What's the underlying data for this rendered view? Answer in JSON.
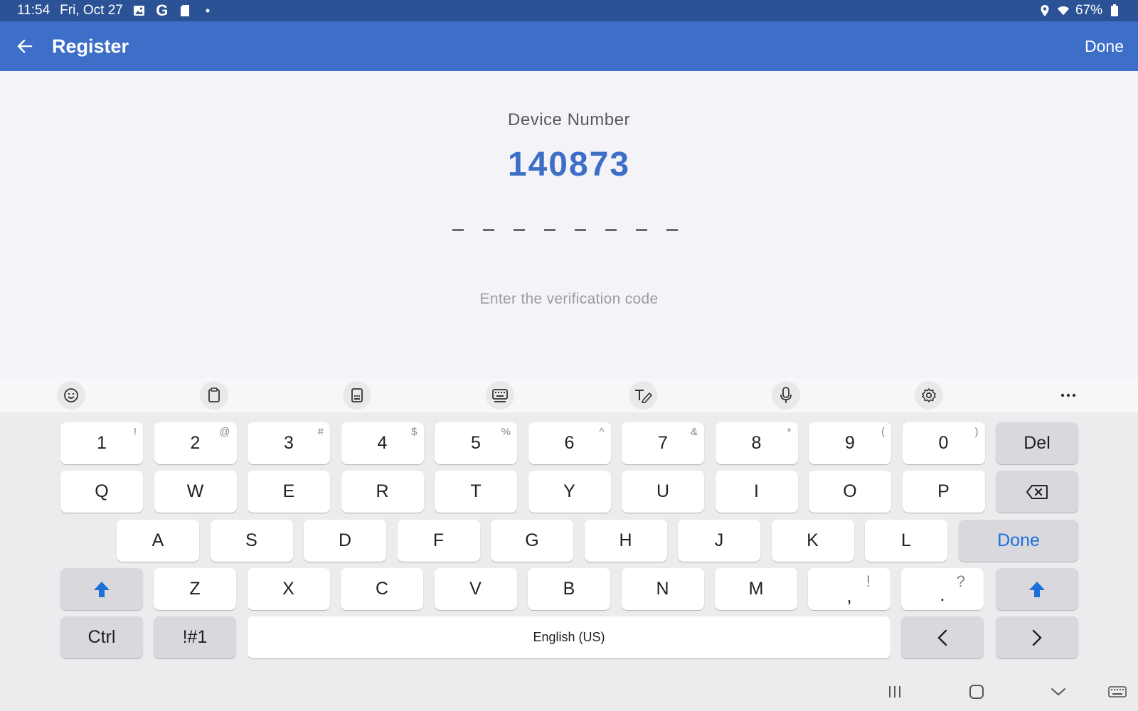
{
  "status_bar": {
    "time": "11:54",
    "date": "Fri, Oct 27",
    "battery": "67%",
    "notification_icons": [
      "gallery-icon",
      "google-icon",
      "sd-card-icon",
      "dot-icon"
    ],
    "system_icons": [
      "location-icon",
      "wifi-icon",
      "battery-icon"
    ]
  },
  "app_bar": {
    "title": "Register",
    "done_label": "Done",
    "color": "#3d6ec8"
  },
  "main": {
    "device_label": "Device Number",
    "device_number": "140873",
    "code_length": 8,
    "hint": "Enter the verification code"
  },
  "keyboard_toolbar": {
    "items": [
      "emoji-icon",
      "clipboard-icon",
      "one-handed-keyboard-icon",
      "keyboard-mode-icon",
      "handwriting-icon",
      "microphone-icon",
      "settings-icon",
      "more-icon"
    ]
  },
  "keyboard": {
    "number_row": [
      {
        "label": "1",
        "alt": "!"
      },
      {
        "label": "2",
        "alt": "@"
      },
      {
        "label": "3",
        "alt": "#"
      },
      {
        "label": "4",
        "alt": "$"
      },
      {
        "label": "5",
        "alt": "%"
      },
      {
        "label": "6",
        "alt": "^"
      },
      {
        "label": "7",
        "alt": "&"
      },
      {
        "label": "8",
        "alt": "*"
      },
      {
        "label": "9",
        "alt": "("
      },
      {
        "label": "0",
        "alt": ")"
      }
    ],
    "del_label": "Del",
    "row_q": [
      "Q",
      "W",
      "E",
      "R",
      "T",
      "Y",
      "U",
      "I",
      "O",
      "P"
    ],
    "row_a": [
      "A",
      "S",
      "D",
      "F",
      "G",
      "H",
      "J",
      "K",
      "L"
    ],
    "done_label": "Done",
    "row_z": [
      "Z",
      "X",
      "C",
      "V",
      "B",
      "N",
      "M"
    ],
    "comma": {
      "label": ",",
      "alt": "!"
    },
    "period": {
      "label": ".",
      "alt": "?"
    },
    "ctrl_label": "Ctrl",
    "symbols_label": "!#1",
    "space_label": "English (US)",
    "left_label": "<",
    "right_label": ">",
    "accent_color": "#1e6fd9"
  },
  "nav_bar": {
    "items": [
      "recent-apps-icon",
      "home-icon",
      "hide-keyboard-icon",
      "keyboard-switch-icon"
    ]
  }
}
